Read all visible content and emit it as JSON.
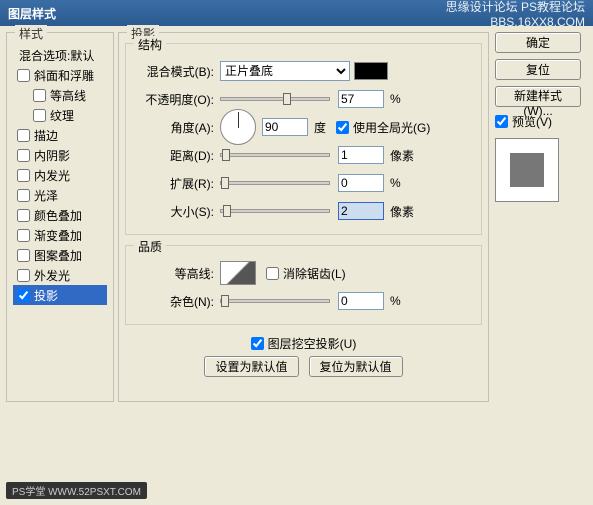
{
  "titlebar": {
    "title": "图层样式",
    "watermark_top": "思缘设计论坛   PS教程论坛",
    "watermark_sub": "BBS.16XX8.COM"
  },
  "styles_panel": {
    "title": "样式",
    "blend_default": "混合选项:默认",
    "items": [
      {
        "label": "斜面和浮雕",
        "checked": false,
        "indent": 0
      },
      {
        "label": "等高线",
        "checked": false,
        "indent": 1
      },
      {
        "label": "纹理",
        "checked": false,
        "indent": 1
      },
      {
        "label": "描边",
        "checked": false,
        "indent": 0
      },
      {
        "label": "内阴影",
        "checked": false,
        "indent": 0
      },
      {
        "label": "内发光",
        "checked": false,
        "indent": 0
      },
      {
        "label": "光泽",
        "checked": false,
        "indent": 0
      },
      {
        "label": "颜色叠加",
        "checked": false,
        "indent": 0
      },
      {
        "label": "渐变叠加",
        "checked": false,
        "indent": 0
      },
      {
        "label": "图案叠加",
        "checked": false,
        "indent": 0
      },
      {
        "label": "外发光",
        "checked": false,
        "indent": 0
      },
      {
        "label": "投影",
        "checked": true,
        "indent": 0,
        "selected": true
      }
    ]
  },
  "main": {
    "title": "投影",
    "structure": {
      "title": "结构",
      "blend_mode_label": "混合模式(B):",
      "blend_mode_value": "正片叠底",
      "color": "#000000",
      "opacity_label": "不透明度(O):",
      "opacity_value": "57",
      "opacity_unit": "%",
      "angle_label": "角度(A):",
      "angle_value": "90",
      "angle_unit": "度",
      "global_light_label": "使用全局光(G)",
      "global_light_checked": true,
      "distance_label": "距离(D):",
      "distance_value": "1",
      "distance_unit": "像素",
      "spread_label": "扩展(R):",
      "spread_value": "0",
      "spread_unit": "%",
      "size_label": "大小(S):",
      "size_value": "2",
      "size_unit": "像素"
    },
    "quality": {
      "title": "品质",
      "contour_label": "等高线:",
      "antialias_label": "消除锯齿(L)",
      "antialias_checked": false,
      "noise_label": "杂色(N):",
      "noise_value": "0",
      "noise_unit": "%"
    },
    "knockout_label": "图层挖空投影(U)",
    "knockout_checked": true,
    "set_default_btn": "设置为默认值",
    "reset_default_btn": "复位为默认值"
  },
  "right": {
    "ok": "确定",
    "cancel": "复位",
    "new_style": "新建样式(W)...",
    "preview_label": "预览(V)",
    "preview_checked": true
  },
  "footer_watermark": "PS学堂  WWW.52PSXT.COM"
}
